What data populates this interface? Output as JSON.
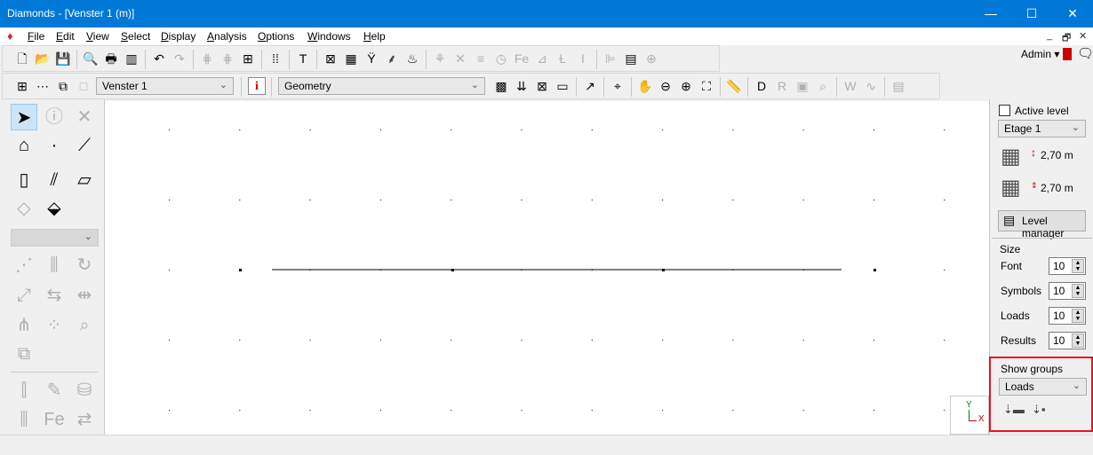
{
  "window": {
    "title": "Diamonds - [Venster 1  (m)]",
    "minimize": "—",
    "maximize": "☐",
    "close": "✕"
  },
  "menu": [
    "File",
    "Edit",
    "View",
    "Select",
    "Display",
    "Analysis",
    "Options",
    "Windows",
    "Help"
  ],
  "mdi_controls": [
    "_",
    "🗗",
    "✕"
  ],
  "user": {
    "name": "Admin ▾"
  },
  "toolbar1": [
    {
      "icon": "new-file-icon",
      "g": "🗋"
    },
    {
      "icon": "open-folder-icon",
      "g": "📂"
    },
    {
      "icon": "save-icon",
      "g": "💾"
    },
    {
      "sep": 1
    },
    {
      "icon": "print-preview-icon",
      "g": "🔍"
    },
    {
      "icon": "print-icon",
      "g": "🖶"
    },
    {
      "icon": "export-icon",
      "g": "▥"
    },
    {
      "sep": 1
    },
    {
      "icon": "undo-icon",
      "g": "↶"
    },
    {
      "icon": "redo-icon",
      "g": "↷",
      "dis": 1
    },
    {
      "sep": 1
    },
    {
      "icon": "grid-lines-icon",
      "g": "⋕",
      "dis": 1
    },
    {
      "icon": "grid-frame-icon",
      "g": "⋕",
      "dis": 1
    },
    {
      "icon": "grid-table-icon",
      "g": "⊞"
    },
    {
      "sep": 1
    },
    {
      "icon": "dot-grid-icon",
      "g": "⁞⁞"
    },
    {
      "sep": 1
    },
    {
      "icon": "color-legend-icon",
      "g": "T"
    },
    {
      "sep": 1
    },
    {
      "icon": "model-icon",
      "g": "⊠"
    },
    {
      "icon": "calculator-icon",
      "g": "▦"
    },
    {
      "icon": "structure-icon",
      "g": "Ÿ"
    },
    {
      "icon": "deformation-icon",
      "g": "⸙"
    },
    {
      "icon": "fire-icon",
      "g": "♨"
    },
    {
      "sep": 1
    },
    {
      "icon": "groups-icon",
      "g": "⚘",
      "dis": 1
    },
    {
      "icon": "cross-icon",
      "g": "✕",
      "dis": 1
    },
    {
      "icon": "foundation-icon",
      "g": "≡",
      "dis": 1
    },
    {
      "icon": "clock-icon",
      "g": "◷",
      "dis": 1
    },
    {
      "icon": "steel-icon",
      "g": "Fe",
      "dis": 1
    },
    {
      "icon": "concrete-icon",
      "g": "⊿",
      "dis": 1
    },
    {
      "icon": "section-icon",
      "g": "Ɫ",
      "dis": 1
    },
    {
      "icon": "beam-icon",
      "g": "I",
      "dis": 1
    },
    {
      "sep": 1
    },
    {
      "icon": "align-icon",
      "g": "⊫",
      "dis": 1
    },
    {
      "icon": "report-icon",
      "g": "▤"
    },
    {
      "icon": "settings-icon",
      "g": "⊕",
      "dis": 1
    }
  ],
  "toolbar2a": [
    {
      "icon": "new-window-icon",
      "g": "⊞"
    },
    {
      "icon": "window-options-icon",
      "g": "⋯"
    },
    {
      "icon": "cascade-icon",
      "g": "⧉"
    },
    {
      "icon": "blank-window-icon",
      "g": "□",
      "dis": 1
    }
  ],
  "window_select": "Venster 1",
  "info_icon": "i",
  "view_select": "Geometry",
  "toolbar2b": [
    {
      "icon": "render-icon",
      "g": "▩"
    },
    {
      "icon": "loads-icon",
      "g": "⇊"
    },
    {
      "icon": "results-icon",
      "g": "⊠"
    },
    {
      "icon": "colormap-icon",
      "g": "▭"
    },
    {
      "sep": 1
    },
    {
      "icon": "pick-icon",
      "g": "↗"
    },
    {
      "sep": 1
    },
    {
      "icon": "axes-icon",
      "g": "⌖"
    },
    {
      "sep": 1
    },
    {
      "icon": "pan-icon",
      "g": "✋"
    },
    {
      "icon": "zoom-out-icon",
      "g": "⊖"
    },
    {
      "icon": "zoom-in-icon",
      "g": "⊕"
    },
    {
      "icon": "zoom-extents-icon",
      "g": "⛶"
    },
    {
      "sep": 1
    },
    {
      "icon": "measure-icon",
      "g": "📏"
    },
    {
      "sep": 1
    },
    {
      "icon": "diamonds-icon",
      "g": "D"
    },
    {
      "icon": "r-icon",
      "g": "R",
      "dis": 1
    },
    {
      "icon": "image-icon",
      "g": "▣",
      "dis": 1
    },
    {
      "icon": "search-icon",
      "g": "⌕",
      "dis": 1
    },
    {
      "sep": 1
    },
    {
      "icon": "word-icon",
      "g": "W",
      "dis": 1
    },
    {
      "icon": "chart-icon",
      "g": "∿",
      "dis": 1
    },
    {
      "sep": 1
    },
    {
      "icon": "document-icon",
      "g": "▤",
      "dis": 1
    }
  ],
  "left_tools": [
    {
      "icon": "select-arrow-icon",
      "g": "➤"
    },
    {
      "icon": "info-bubble-icon",
      "g": "ⓘ",
      "dis": 1
    },
    {
      "icon": "delete-icon",
      "g": "✕",
      "dis": 1
    },
    {
      "icon": "grid-plane-icon",
      "g": "⌂"
    },
    {
      "icon": "node-icon",
      "g": "·"
    },
    {
      "icon": "line-icon",
      "g": "⟋"
    },
    {
      "icon": "column-icon",
      "g": "▯"
    },
    {
      "icon": "beam-icon",
      "g": "⫽"
    },
    {
      "icon": "wall-icon",
      "g": "▱"
    },
    {
      "icon": "slab-icon",
      "g": "◇",
      "dis": 1
    },
    {
      "icon": "foundation-icon",
      "g": "⬙"
    },
    {
      "icon": "connect-icon",
      "g": "⋰",
      "dis": 1
    },
    {
      "icon": "distribute-icon",
      "g": "⫼",
      "dis": 1
    },
    {
      "icon": "rotate-icon",
      "g": "↻",
      "dis": 1
    },
    {
      "icon": "move-icon",
      "g": "⤢",
      "dis": 1
    },
    {
      "icon": "reflect-icon",
      "g": "⇆",
      "dis": 1
    },
    {
      "icon": "split-icon",
      "g": "⇹",
      "dis": 1
    },
    {
      "icon": "mesh-icon",
      "g": "⋔",
      "dis": 1
    },
    {
      "icon": "nodes-icon",
      "g": "⁘",
      "dis": 1
    },
    {
      "icon": "find-icon",
      "g": "⌕",
      "dis": 1
    },
    {
      "icon": "scale-icon",
      "g": "⧉",
      "dis": 1
    },
    {
      "icon": "section-check-icon",
      "g": "⫿",
      "dis": 1
    },
    {
      "icon": "check-icon",
      "g": "✎",
      "dis": 1
    },
    {
      "icon": "stack-icon",
      "g": "⛁",
      "dis": 1
    },
    {
      "icon": "bars-icon",
      "g": "⫼",
      "dis": 1
    },
    {
      "icon": "rebar-icon",
      "g": "Fe",
      "dis": 1
    },
    {
      "icon": "transfer-icon",
      "g": "⇄",
      "dis": 1
    }
  ],
  "right_panel": {
    "active_level": "Active level",
    "level": "Etage 1",
    "height1": "2,70 m",
    "height2": "2,70 m",
    "level_manager": "Level manager",
    "size_title": "Size",
    "sizes": [
      {
        "label": "Font",
        "value": "10"
      },
      {
        "label": "Symbols",
        "value": "10"
      },
      {
        "label": "Loads",
        "value": "10"
      },
      {
        "label": "Results",
        "value": "10"
      }
    ],
    "show_groups": "Show groups",
    "group": "Loads"
  },
  "axes": {
    "y": "Y",
    "x": "X"
  },
  "colors": {
    "title": "#0078d7",
    "highlight": "#e81123"
  }
}
